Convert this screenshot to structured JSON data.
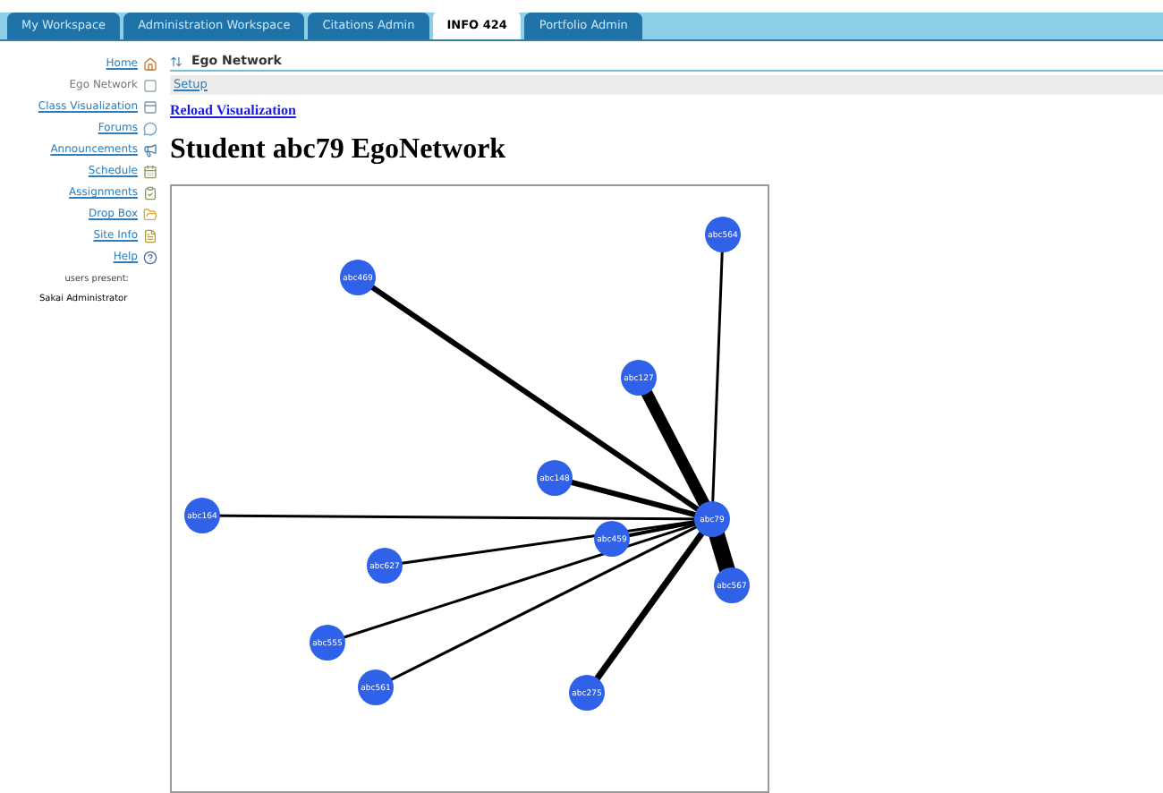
{
  "tabs": [
    {
      "label": "My Workspace",
      "selected": false
    },
    {
      "label": "Administration Workspace",
      "selected": false
    },
    {
      "label": "Citations Admin",
      "selected": false
    },
    {
      "label": "INFO 424",
      "selected": true
    },
    {
      "label": "Portfolio Admin",
      "selected": false
    }
  ],
  "sidebar": {
    "items": [
      {
        "label": "Home",
        "selected": false
      },
      {
        "label": "Ego Network",
        "selected": true
      },
      {
        "label": "Class Visualization",
        "selected": false
      },
      {
        "label": "Forums",
        "selected": false
      },
      {
        "label": "Announcements",
        "selected": false
      },
      {
        "label": "Schedule",
        "selected": false
      },
      {
        "label": "Assignments",
        "selected": false
      },
      {
        "label": "Drop Box",
        "selected": false
      },
      {
        "label": "Site Info",
        "selected": false
      },
      {
        "label": "Help",
        "selected": false
      }
    ],
    "users_present_label": "users present:",
    "users": [
      "Sakai Administrator"
    ]
  },
  "tool_title": "Ego Network",
  "toolbar_links": [
    "Setup"
  ],
  "reload_link": "Reload Visualization",
  "heading": "Student abc79 EgoNetwork",
  "network": {
    "center": "abc79",
    "nodes": [
      {
        "label": "abc469"
      },
      {
        "label": "abc564"
      },
      {
        "label": "abc127"
      },
      {
        "label": "abc148"
      },
      {
        "label": "abc164"
      },
      {
        "label": "abc459"
      },
      {
        "label": "abc627"
      },
      {
        "label": "abc567"
      },
      {
        "label": "abc555"
      },
      {
        "label": "abc561"
      },
      {
        "label": "abc275"
      }
    ]
  }
}
